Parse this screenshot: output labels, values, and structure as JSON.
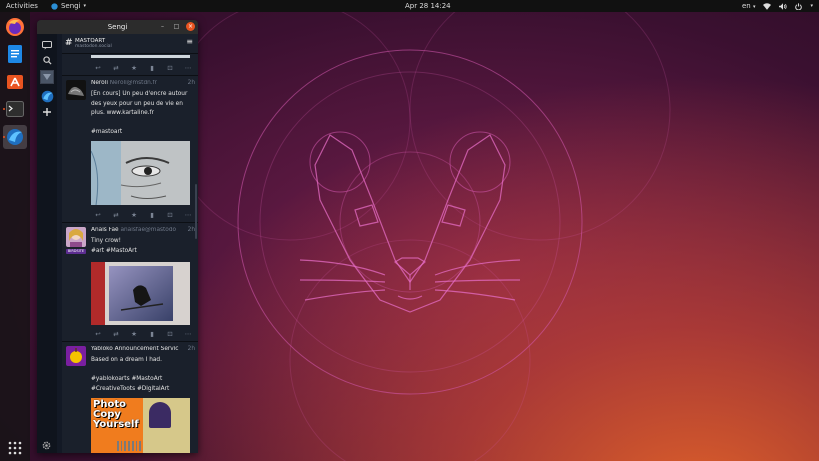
{
  "topbar": {
    "activities": "Activities",
    "app_name": "Sengi",
    "clock": "Apr 28  14:24",
    "keyboard": "en"
  },
  "window": {
    "title": "Sengi",
    "column": {
      "hashtag": "#",
      "name": "MASTOART",
      "instance": "mastodon.social"
    }
  },
  "statuses": [
    {
      "display_name": "Néroli",
      "account": "Neroli@mstdn.fr",
      "time": "2h",
      "lines": [
        "[En cours] Un peu d'encre autour",
        "des yeux pour un peu de vie en",
        "plus. www.kartaline.fr",
        "",
        "#mastoart"
      ]
    },
    {
      "display_name": "Anaïs Faë",
      "account": "anaisfae@mastodo",
      "time": "2h",
      "badge": "BIRDSITE",
      "lines": [
        "Tiny crow!",
        "#art #MastoArt"
      ]
    },
    {
      "display_name": "Yabloko Announcement Servic",
      "account": "",
      "time": "2h",
      "lines": [
        "Based on a dream I had.",
        "",
        "#yablokoarts #MastoArt",
        "#CreativeToots #DigitalArt"
      ],
      "image_text": "Photo Copy Yourself"
    }
  ],
  "icons": {
    "reply": "reply-icon",
    "boost": "boost-icon",
    "favorite": "star-icon",
    "bookmark": "bookmark-icon",
    "open": "open-icon",
    "more": "more-icon"
  },
  "colors": {
    "accent": "#e95420",
    "column_bg": "#1a202b",
    "bot_badge": "#5c2d91"
  }
}
